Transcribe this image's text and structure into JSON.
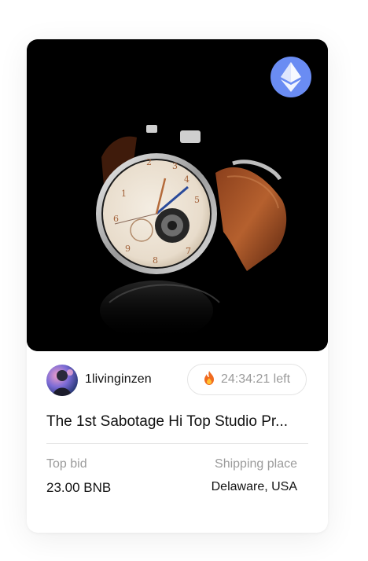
{
  "product": {
    "chain_icon": "ethereum-icon",
    "owner": {
      "name": "1livinginzen"
    },
    "timer": {
      "icon": "fire-icon",
      "label": "24:34:21 left"
    },
    "title": "The 1st Sabotage Hi Top Studio Pr...",
    "top_bid": {
      "label": "Top bid",
      "value": "23.00 BNB"
    },
    "shipping": {
      "label": "Shipping place",
      "value": "Delaware, USA"
    }
  },
  "colors": {
    "eth_badge": "#6a8cf3",
    "muted_text": "#9b9b9b",
    "primary_text": "#111111"
  }
}
